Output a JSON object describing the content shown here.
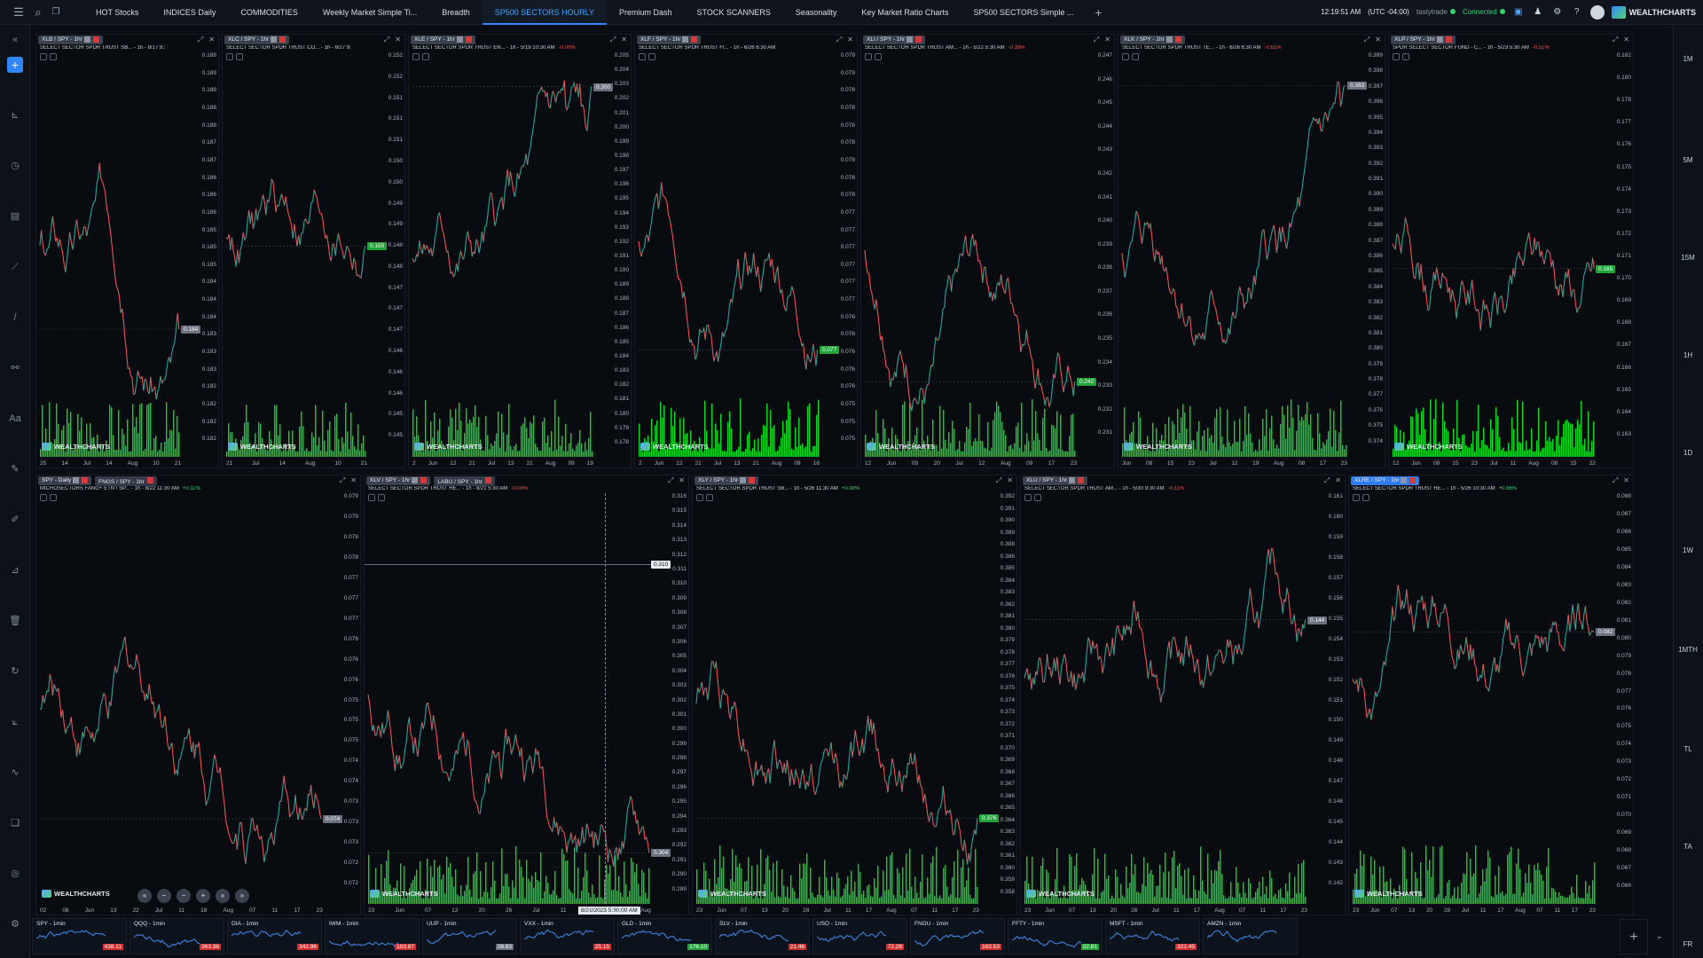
{
  "topbar": {
    "tabs": [
      {
        "label": "HOT Stocks",
        "active": false
      },
      {
        "label": "INDICES Daily",
        "active": false
      },
      {
        "label": "COMMODITIES",
        "active": false
      },
      {
        "label": "Weekly Market Simple Ti...",
        "active": false
      },
      {
        "label": "Breadth",
        "active": false
      },
      {
        "label": "SP500 SECTORS HOURLY",
        "active": true
      },
      {
        "label": "Premium Dash",
        "active": false
      },
      {
        "label": "STOCK SCANNERS",
        "active": false
      },
      {
        "label": "Seasonality",
        "active": false
      },
      {
        "label": "Key Market Ratio Charts",
        "active": false
      },
      {
        "label": "SP500 SECTORS Simple ...",
        "active": false
      }
    ],
    "add_tab": "+",
    "clock": "12:19:51 AM",
    "timezone": "(UTC -04:00)",
    "broker": "tastytrade",
    "status": "Connected",
    "brand": "WEALTHCHARTS",
    "icons": [
      "menu-icon",
      "search-icon",
      "copy-icon",
      "cart-icon",
      "bell-icon",
      "gear-icon",
      "help-icon",
      "avatar"
    ]
  },
  "left_tools": [
    "collapse-icon",
    "plus-icon",
    "ruler-icon",
    "clock-icon",
    "calendar-icon",
    "trend-icon",
    "line-icon",
    "link-icon",
    "text-icon",
    "pencil-icon",
    "brush-icon",
    "measure-icon",
    "trash-icon",
    "refresh-icon",
    "chart-icon",
    "indicator-icon",
    "layers-icon",
    "target-icon",
    "settings-icon"
  ],
  "right_timeframes": [
    "1M",
    "5M",
    "15M",
    "1H",
    "1D",
    "1W",
    "1MTH",
    "TL",
    "TA",
    "FR"
  ],
  "colors": {
    "up": "#26a69a",
    "down": "#ef5350",
    "volume": "#00ff2a",
    "accent": "#2f86ff"
  },
  "panels": [
    {
      "tag": "XLB / SPY - 1hr",
      "desc": "SELECT SECTOR SPDR TRUST SB... - 1h - 8/17 9:30 AM",
      "chg": "",
      "y": [
        "0.189",
        "0.189",
        "0.188",
        "0.188",
        "0.188",
        "0.187",
        "0.187",
        "0.186",
        "0.186",
        "0.186",
        "0.185",
        "0.185",
        "0.185",
        "0.184",
        "0.184",
        "0.184",
        "0.183",
        "0.183",
        "0.183",
        "0.182",
        "0.182",
        "0.182",
        "0.182"
      ],
      "price": "0.184",
      "price_color": "#6b7380",
      "x": [
        "25",
        "14",
        "Jul",
        "14",
        "Aug",
        "10",
        "21"
      ],
      "has_volume": true
    },
    {
      "tag": "XLC / SPY - 1hr",
      "desc": "SELECT SECTOR SPDR TRUST CO... - 1h - 6/27 9:30 AM",
      "chg": "",
      "y": [
        "0.152",
        "0.152",
        "0.151",
        "0.151",
        "0.151",
        "0.150",
        "0.150",
        "0.149",
        "0.149",
        "0.148",
        "0.148",
        "0.147",
        "0.147",
        "0.147",
        "0.146",
        "0.146",
        "0.146",
        "0.145",
        "0.145"
      ],
      "price": "0.150",
      "price_color": "#21a43a",
      "x": [
        "21",
        "Jul",
        "14",
        "Aug",
        "10",
        "21"
      ],
      "has_volume": true
    },
    {
      "tag": "XLE / SPY - 1hr",
      "desc": "SELECT SECTOR SPDR TRUST EN... - 1h - 5/19 10:30 AM",
      "chg": "-0.00%",
      "y": [
        "0.205",
        "0.204",
        "0.203",
        "0.202",
        "0.201",
        "0.200",
        "0.199",
        "0.198",
        "0.197",
        "0.196",
        "0.195",
        "0.194",
        "0.193",
        "0.192",
        "0.191",
        "0.190",
        "0.189",
        "0.188",
        "0.187",
        "0.186",
        "0.185",
        "0.184",
        "0.183",
        "0.182",
        "0.181",
        "0.180",
        "0.179",
        "0.178"
      ],
      "price": "0.200",
      "price_color": "#6b7380",
      "x": [
        "2",
        "Jun",
        "12",
        "21",
        "Jul",
        "13",
        "21",
        "Aug",
        "09",
        "18"
      ],
      "has_volume": true
    },
    {
      "tag": "XLF / SPY - 1hr",
      "desc": "SELECT SECTOR SPDR TRUST FI... - 1h - 6/26 6:30 AM",
      "chg": "",
      "y": [
        "0.079",
        "0.079",
        "0.078",
        "0.078",
        "0.078",
        "0.078",
        "0.078",
        "0.078",
        "0.078",
        "0.077",
        "0.077",
        "0.077",
        "0.077",
        "0.077",
        "0.077",
        "0.076",
        "0.076",
        "0.076",
        "0.076",
        "0.076",
        "0.075",
        "0.075",
        "0.075"
      ],
      "price": "0.077",
      "price_color": "#21a43a",
      "x": [
        "2",
        "Jun",
        "12",
        "21",
        "Jul",
        "13",
        "21",
        "Aug",
        "09",
        "18"
      ],
      "has_volume": true
    },
    {
      "tag": "XLI / SPY - 1hr",
      "desc": "SELECT SECTOR SPDR TRUST AM... - 1h - 5/22 5:30 AM",
      "chg": "-0.39%",
      "y": [
        "0.247",
        "0.246",
        "0.245",
        "0.244",
        "0.243",
        "0.242",
        "0.241",
        "0.240",
        "0.239",
        "0.238",
        "0.237",
        "0.236",
        "0.235",
        "0.234",
        "0.233",
        "0.232",
        "0.231"
      ],
      "price": "0.242",
      "price_color": "#21a43a",
      "x": [
        "12",
        "Jun",
        "09",
        "20",
        "Jul",
        "12",
        "Aug",
        "09",
        "17",
        "23"
      ],
      "has_volume": true
    },
    {
      "tag": "XLK / SPY - 1hr",
      "desc": "SELECT SECTOR SPDR TRUST TE... - 1h - 6/26 6:30 AM",
      "chg": "-0.61%",
      "y": [
        "0.399",
        "0.398",
        "0.397",
        "0.396",
        "0.395",
        "0.394",
        "0.393",
        "0.392",
        "0.391",
        "0.390",
        "0.389",
        "0.388",
        "0.387",
        "0.386",
        "0.385",
        "0.384",
        "0.383",
        "0.382",
        "0.381",
        "0.380",
        "0.379",
        "0.378",
        "0.377",
        "0.376",
        "0.375",
        "0.374"
      ],
      "price": "0.383",
      "price_color": "#6b7380",
      "x": [
        "Jun",
        "08",
        "15",
        "23",
        "Jul",
        "12",
        "19",
        "Aug",
        "08",
        "17",
        "23"
      ],
      "has_volume": true
    },
    {
      "tag": "XLP / SPY - 1hr",
      "desc": "SPDR SELECT SECTOR FUND - C... - 1h - 5/23 5:30 AM",
      "chg": "-0.51%",
      "y": [
        "0.182",
        "0.180",
        "0.178",
        "0.177",
        "0.176",
        "0.175",
        "0.174",
        "0.173",
        "0.172",
        "0.171",
        "0.170",
        "0.169",
        "0.168",
        "0.167",
        "0.166",
        "0.165",
        "0.164",
        "0.163"
      ],
      "price": "0.165",
      "price_color": "#21a43a",
      "x": [
        "12",
        "Jun",
        "08",
        "15",
        "23",
        "Jul",
        "11",
        "Aug",
        "08",
        "15",
        "22"
      ],
      "has_volume": true
    },
    {
      "tag": "SPY - Daily",
      "tag2": "FNGS / SPY - 1hr",
      "desc": "MICROSECTORS FANG+ ETN / SP... - 1h - 8/22 11:30 AM",
      "chg": "+0.11%",
      "y": [
        "0.079",
        "0.079",
        "0.078",
        "0.078",
        "0.077",
        "0.077",
        "0.077",
        "0.076",
        "0.076",
        "0.076",
        "0.075",
        "0.075",
        "0.075",
        "0.074",
        "0.074",
        "0.073",
        "0.073",
        "0.073",
        "0.072",
        "0.072"
      ],
      "price": "0.074",
      "price_color": "#6b7380",
      "x": [
        "02",
        "08",
        "Jun",
        "13",
        "22",
        "Jul",
        "11",
        "18",
        "Aug",
        "07",
        "11",
        "17",
        "23"
      ],
      "has_volume": false
    },
    {
      "tag": "XLV / SPY - 1hr",
      "tag2": "LABU / SPY - 1hr",
      "desc": "SELECT SECTOR SPDR TRUST HE... - 1h - 8/21 5:30 AM",
      "chg": "-0.09%",
      "y": [
        "0.316",
        "0.315",
        "0.314",
        "0.313",
        "0.312",
        "0.311",
        "0.310",
        "0.309",
        "0.308",
        "0.307",
        "0.306",
        "0.305",
        "0.304",
        "0.303",
        "0.302",
        "0.301",
        "0.300",
        "0.299",
        "0.298",
        "0.297",
        "0.296",
        "0.295",
        "0.294",
        "0.293",
        "0.292",
        "0.291",
        "0.290",
        "0.289"
      ],
      "price": "0.304",
      "price_color": "#6b7380",
      "cursor_price": "0.310",
      "cursor_date": "8/21/2023 5:30:00 AM",
      "x": [
        "23",
        "Jun",
        "07",
        "13",
        "20",
        "26",
        "Jul",
        "11",
        "17",
        "21",
        "Aug"
      ],
      "has_volume": true
    },
    {
      "tag": "XLY / SPY - 1hr",
      "desc": "SELECT SECTOR SPDR TRUST SB... - 1h - 5/26 11:30 AM",
      "chg": "+0.98%",
      "y": [
        "0.392",
        "0.391",
        "0.390",
        "0.389",
        "0.388",
        "0.386",
        "0.385",
        "0.384",
        "0.383",
        "0.382",
        "0.381",
        "0.380",
        "0.379",
        "0.378",
        "0.377",
        "0.376",
        "0.375",
        "0.374",
        "0.373",
        "0.372",
        "0.371",
        "0.370",
        "0.369",
        "0.368",
        "0.367",
        "0.366",
        "0.365",
        "0.364",
        "0.363",
        "0.362",
        "0.361",
        "0.360",
        "0.359",
        "0.358"
      ],
      "price": "0.376",
      "price_color": "#21a43a",
      "x": [
        "23",
        "Jun",
        "07",
        "13",
        "20",
        "28",
        "Jul",
        "11",
        "17",
        "Aug",
        "07",
        "11",
        "17",
        "23"
      ],
      "has_volume": true
    },
    {
      "tag": "XLU / SPY - 1hr",
      "desc": "SELECT SECTOR SPDR TRUST AM... - 1h - 5/30 9:30 AM",
      "chg": "-0.11%",
      "y": [
        "0.161",
        "0.160",
        "0.159",
        "0.158",
        "0.157",
        "0.156",
        "0.155",
        "0.154",
        "0.153",
        "0.152",
        "0.151",
        "0.150",
        "0.149",
        "0.148",
        "0.147",
        "0.146",
        "0.145",
        "0.144",
        "0.143",
        "0.142"
      ],
      "price": "0.144",
      "price_color": "#6b7380",
      "x": [
        "23",
        "Jun",
        "07",
        "13",
        "20",
        "26",
        "Jul",
        "11",
        "17",
        "Aug",
        "07",
        "11",
        "17",
        "23"
      ],
      "has_volume": true
    },
    {
      "tag": "XLRE / SPY - 1hr",
      "desc": "SELECT SECTOR SPDR TRUST RE... - 1h - 5/26 10:30 AM",
      "chg": "+0.86%",
      "y": [
        "0.088",
        "0.087",
        "0.086",
        "0.085",
        "0.084",
        "0.083",
        "0.082",
        "0.081",
        "0.080",
        "0.079",
        "0.078",
        "0.077",
        "0.076",
        "0.075",
        "0.074",
        "0.073",
        "0.072",
        "0.071",
        "0.070",
        "0.069",
        "0.068",
        "0.067",
        "0.066"
      ],
      "price": "0.082",
      "price_color": "#6b7380",
      "x": [
        "23",
        "Jun",
        "07",
        "13",
        "20",
        "28",
        "Jul",
        "11",
        "17",
        "Aug",
        "07",
        "11",
        "17",
        "23"
      ],
      "has_volume": true,
      "active": true
    }
  ],
  "watermark": "WEALTHCHARTS",
  "nav_buttons": [
    "«",
    "−",
    "−",
    "+",
    "»",
    "»"
  ],
  "tickers": [
    {
      "name": "SPY - 1min",
      "price": "438.11",
      "color": "#d32f2f"
    },
    {
      "name": "QQQ - 1min",
      "price": "363.36",
      "color": "#d32f2f"
    },
    {
      "name": "DIA - 1min",
      "price": "342.96",
      "color": "#d32f2f"
    },
    {
      "name": "IWM - 1min",
      "price": "183.87",
      "color": "#d32f2f"
    },
    {
      "name": "UUP - 1min",
      "price": "28.83",
      "color": "#6b7380"
    },
    {
      "name": "VXX - 1min",
      "price": "25.15",
      "color": "#d32f2f"
    },
    {
      "name": "GLD - 1min",
      "price": "176.10",
      "color": "#21a43a"
    },
    {
      "name": "SLV - 1min",
      "price": "21.46",
      "color": "#d32f2f"
    },
    {
      "name": "USO - 1min",
      "price": "72.28",
      "color": "#d32f2f"
    },
    {
      "name": "FNGU - 1min",
      "price": "162.53",
      "color": "#d32f2f"
    },
    {
      "name": "FFTY - 1min",
      "price": "22.81",
      "color": "#21a43a"
    },
    {
      "name": "MSFT - 1min",
      "price": "322.45",
      "color": "#d32f2f"
    },
    {
      "name": "AMZN - 1min",
      "price": "",
      "color": "#d32f2f"
    }
  ],
  "ticker_add": "+"
}
